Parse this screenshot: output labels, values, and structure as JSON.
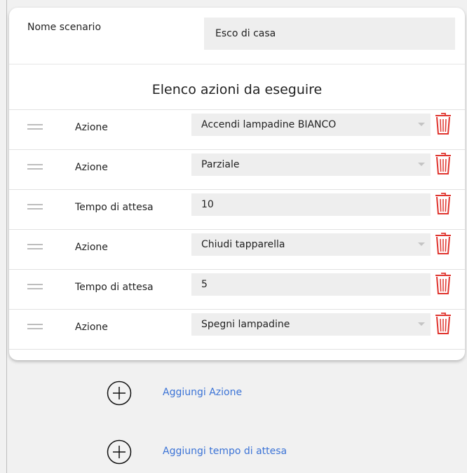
{
  "scenario": {
    "name_label": "Nome scenario",
    "name_value": "Esco di casa"
  },
  "actions_list": {
    "title": "Elenco azioni da eseguire",
    "rows": [
      {
        "label": "Azione",
        "value": "Accendi lampadine BIANCO",
        "type": "select"
      },
      {
        "label": "Azione",
        "value": "Parziale",
        "type": "select"
      },
      {
        "label": "Tempo di attesa",
        "value": "10",
        "type": "input"
      },
      {
        "label": "Azione",
        "value": "Chiudi tapparella",
        "type": "select"
      },
      {
        "label": "Tempo di attesa",
        "value": "5",
        "type": "input"
      },
      {
        "label": "Azione",
        "value": "Spegni lampadine",
        "type": "select"
      }
    ]
  },
  "buttons": {
    "add_action": "Aggiungi Azione",
    "add_wait": "Aggiungi tempo di attesa"
  },
  "icons": {
    "handle": "drag-handle-icon",
    "delete": "trash-icon",
    "add": "plus-circle-icon",
    "dropdown": "chevron-down-icon"
  },
  "colors": {
    "accent_link": "#3b73d6",
    "delete_red": "#e0352f",
    "field_bg": "#eeeeee",
    "page_bg": "#f1f1f1"
  }
}
